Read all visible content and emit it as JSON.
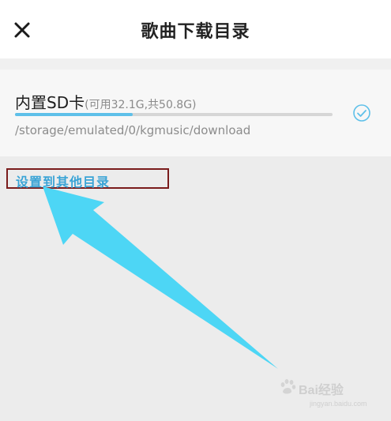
{
  "header": {
    "title": "歌曲下载目录",
    "close_icon": "close-icon"
  },
  "storage": {
    "name": "内置SD卡",
    "capacity": "(可用32.1G,共50.8G)",
    "usage_fraction": 0.37,
    "path": "/storage/emulated/0/kgmusic/download",
    "selected_icon": "check-circle-icon",
    "accent": "#5ec0e9"
  },
  "action": {
    "set_other_dir": "设置到其他目录"
  },
  "annotation": {
    "arrow_color": "#4dd6f5",
    "box_color": "#7a1c1c"
  },
  "watermark": {
    "main": "Bai经验",
    "sub": "jingyan.baidu.com"
  }
}
